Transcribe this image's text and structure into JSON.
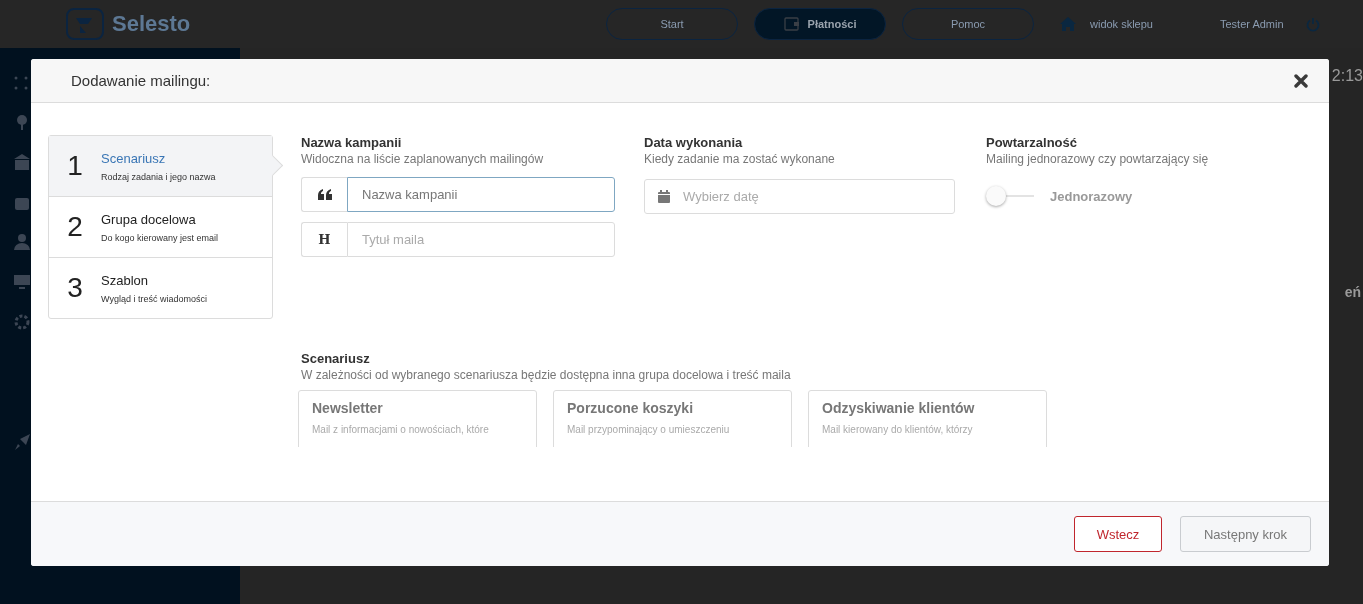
{
  "topbar": {
    "logo_text": "Selesto",
    "nav": [
      {
        "label": "Start",
        "selected": false
      },
      {
        "label": "Płatności",
        "selected": true
      },
      {
        "label": "Pomoc",
        "selected": false
      }
    ],
    "shop_link": "widok sklepu",
    "user": "Tester Admin"
  },
  "background_fragments": {
    "time": "2:13",
    "column_heading": "eń"
  },
  "modal": {
    "title": "Dodawanie mailingu:",
    "steps": [
      {
        "number": "1",
        "title": "Scenariusz",
        "subtitle": "Rodzaj zadania i jego nazwa",
        "selected": true
      },
      {
        "number": "2",
        "title": "Grupa docelowa",
        "subtitle": "Do kogo kierowany jest email",
        "selected": false
      },
      {
        "number": "3",
        "title": "Szablon",
        "subtitle": "Wygląd i treść wiadomości",
        "selected": false
      }
    ],
    "campaign": {
      "label": "Nazwa kampanii",
      "hint": "Widoczna na liście zaplanowanych mailingów",
      "inputs": [
        {
          "kind": "quote",
          "placeholder": "Nazwa kampanii",
          "focused": true
        },
        {
          "kind": "heading",
          "icon_char": "H",
          "placeholder": "Tytuł maila",
          "focused": false
        }
      ]
    },
    "date": {
      "label": "Data wykonania",
      "hint": "Kiedy zadanie ma zostać wykonane",
      "placeholder": "Wybierz datę"
    },
    "repeat": {
      "label": "Powtarzalność",
      "hint": "Mailing jednorazowy czy powtarzający się",
      "toggle": {
        "on": false,
        "label": "Jednorazowy"
      }
    },
    "scenario": {
      "label": "Scenariusz",
      "hint": "W zależności od wybranego scenariusza będzie dostępna inna grupa docelowa i treść maila",
      "options": [
        {
          "title": "Newsletter",
          "description": "Mail z informacjami o nowościach, które",
          "selected": false
        },
        {
          "title": "Porzucone koszyki",
          "description": "Mail przypominający o umieszczeniu",
          "selected": false
        },
        {
          "title": "Odzyskiwanie klientów",
          "description": "Mail kierowany do klientów, którzy",
          "selected": false
        }
      ]
    },
    "buttons": [
      {
        "kind": "back",
        "label": "Wstecz",
        "disabled": false
      },
      {
        "kind": "next",
        "label": "Następny krok",
        "disabled": true
      }
    ]
  }
}
